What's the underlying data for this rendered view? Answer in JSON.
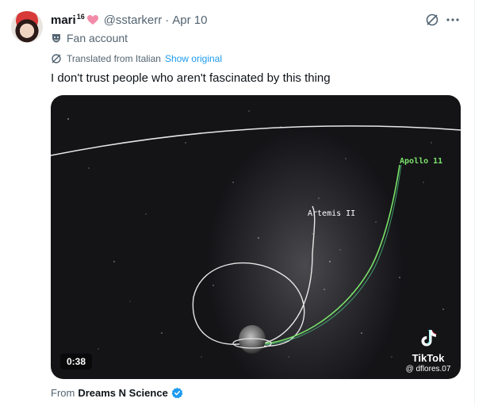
{
  "post": {
    "display_name": "mari",
    "name_superscript": "16",
    "handle": "@sstarkerr",
    "separator": "·",
    "date": "Apr 10",
    "badge_label": "Fan account",
    "translated_label": "Translated from Italian",
    "show_original_label": "Show original",
    "text": "I don't trust people who aren't fascinated by this thing"
  },
  "media": {
    "duration": "0:38",
    "label_apollo": "Apollo 11",
    "label_artemis": "Artemis II",
    "watermark_brand": "TikTok",
    "watermark_user": "@ dflores.07"
  },
  "source": {
    "prefix": "From",
    "name": "Dreams N Science"
  },
  "colors": {
    "accent": "#1d9bf0",
    "apollo_line": "#7be36a",
    "artemis_line": "#e6e6e6",
    "heart": "#f28ba8"
  }
}
